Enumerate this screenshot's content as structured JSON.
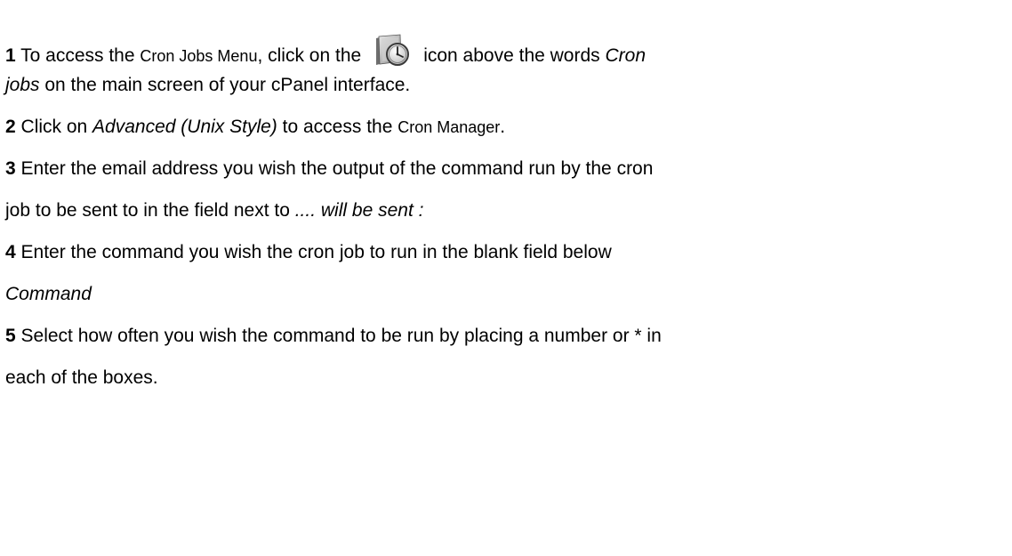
{
  "steps": [
    {
      "number": "1",
      "line1_pre": " To access the ",
      "line1_small": "Cron Jobs Menu",
      "line1_mid": ", click on the",
      "icon": "cron-clock-folder-icon",
      "line1_post": "icon above the words ",
      "line1_italic": "Cron",
      "line2_italic": "jobs",
      "line2_post": " on the main screen of your cPanel interface."
    },
    {
      "number": "2",
      "pre": " Click on ",
      "italic": "Advanced (Unix Style)",
      "mid": " to access the ",
      "small": "Cron Manager",
      "post": "."
    },
    {
      "number": "3",
      "line1": " Enter the email address you wish the output of the command run by the cron",
      "line2_pre": "job to be sent to in the field next to ",
      "line2_italic": ".... will be sent :"
    },
    {
      "number": "4",
      "line1": " Enter the command you wish the cron job to run in the blank field below",
      "line2_italic": "Command"
    },
    {
      "number": "5",
      "line1": " Select how often you wish the command to be run by placing a number or * in",
      "line2": "each of the boxes."
    }
  ]
}
